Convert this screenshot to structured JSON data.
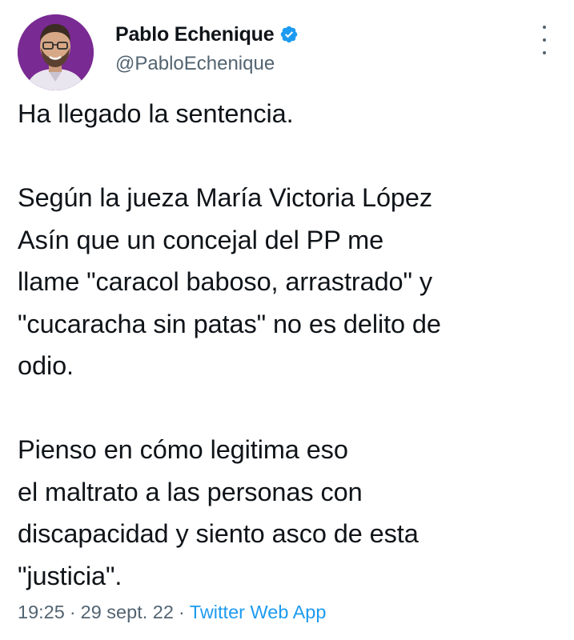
{
  "author": {
    "display_name": "Pablo Echenique",
    "handle": "@PabloEchenique",
    "verified": true
  },
  "tweet": {
    "paragraphs": [
      [
        "Ha llegado la sentencia."
      ],
      [
        "Según la jueza María Victoria López",
        "Asín que un concejal del PP me",
        "llame \"caracol baboso, arrastrado\" y",
        "\"cucaracha sin patas\" no es delito de",
        "odio."
      ],
      [
        "Pienso en cómo legitima eso",
        "el maltrato a las personas con",
        "discapacidad y siento asco de esta",
        "\"justicia\"."
      ]
    ]
  },
  "meta": {
    "time": "19:25",
    "separator": "·",
    "date": "29 sept. 22",
    "source": "Twitter Web App"
  },
  "icons": {
    "verified": "verified-badge-icon",
    "more": "more-vertical-icon"
  },
  "colors": {
    "accent": "#1d9bf0",
    "secondary_text": "#536471",
    "avatar_background": "#7a2a93"
  }
}
